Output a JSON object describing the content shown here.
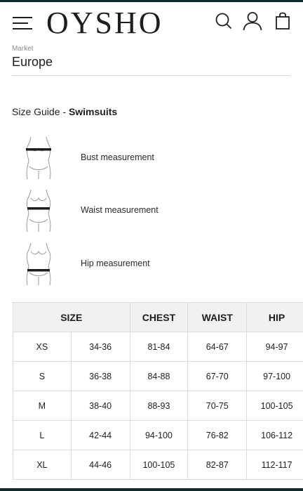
{
  "header": {
    "brand": "OYSHO",
    "icons": [
      "menu-icon",
      "search-icon",
      "user-icon",
      "shopping-bag-icon"
    ]
  },
  "market": {
    "label": "Market",
    "value": "Europe"
  },
  "guide": {
    "title_prefix": "Size Guide - ",
    "title_category": "Swimsuits"
  },
  "measurements": [
    {
      "label": "Bust measurement"
    },
    {
      "label": "Waist measurement"
    },
    {
      "label": "Hip measurement"
    }
  ],
  "size_table": {
    "headers": [
      "SIZE",
      "CHEST",
      "WAIST",
      "HIP"
    ],
    "rows": [
      [
        "XS",
        "34-36",
        "81-84",
        "64-67",
        "94-97"
      ],
      [
        "S",
        "36-38",
        "84-88",
        "67-70",
        "97-100"
      ],
      [
        "M",
        "38-40",
        "88-93",
        "70-75",
        "100-105"
      ],
      [
        "L",
        "42-44",
        "94-100",
        "76-82",
        "106-112"
      ],
      [
        "XL",
        "44-46",
        "100-105",
        "82-87",
        "112-117"
      ]
    ]
  },
  "colors": {
    "text": "#1e1e1e",
    "muted": "#8a8a8a",
    "header_bg": "#f1f1f1",
    "border": "#dcdcdc",
    "frame": "#0f2a2c"
  }
}
